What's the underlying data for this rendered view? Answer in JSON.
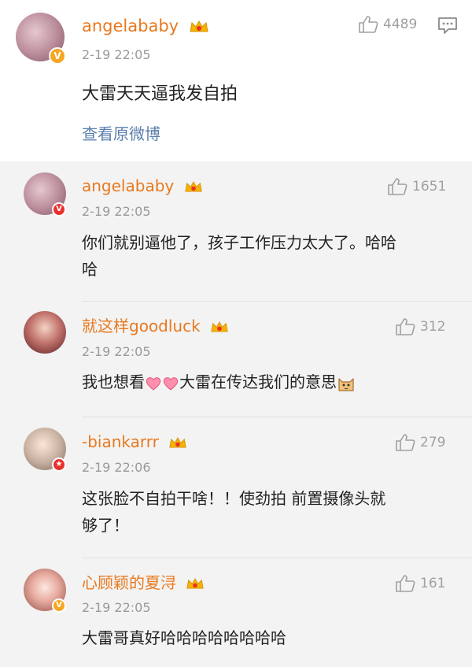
{
  "main_comment": {
    "name": "angelababy",
    "time": "2-19 22:05",
    "text": "大雷天天逼我发自拍",
    "link": "查看原微博",
    "likes": "4489"
  },
  "replies": [
    {
      "name": "angelababy",
      "time": "2-19 22:05",
      "text_line1": "你们就别逼他了，孩子工作压力太大了。哈哈",
      "text_line2": "哈",
      "likes": "1651"
    },
    {
      "name": "就这样goodluck",
      "time": "2-19 22:05",
      "text_a": "我也想看",
      "text_b": "大雷在传达我们的意思",
      "likes": "312"
    },
    {
      "name": "-biankarrr",
      "time": "2-19 22:06",
      "text_line1": "这张脸不自拍干啥！！使劲拍 前置摄像头就",
      "text_line2": "够了！",
      "likes": "279"
    },
    {
      "name": "心顾颖的夏浔",
      "time": "2-19 22:05",
      "text_line1": "大雷哥真好哈哈哈哈哈哈哈哈",
      "likes": "161"
    }
  ],
  "icons": {
    "like": "thumbs-up-icon",
    "comment": "comment-icon",
    "crown": "crown-icon",
    "verified": "verified-badge-icon",
    "heart": "heart-emoji-icon",
    "cat": "cat-emoji-icon"
  }
}
